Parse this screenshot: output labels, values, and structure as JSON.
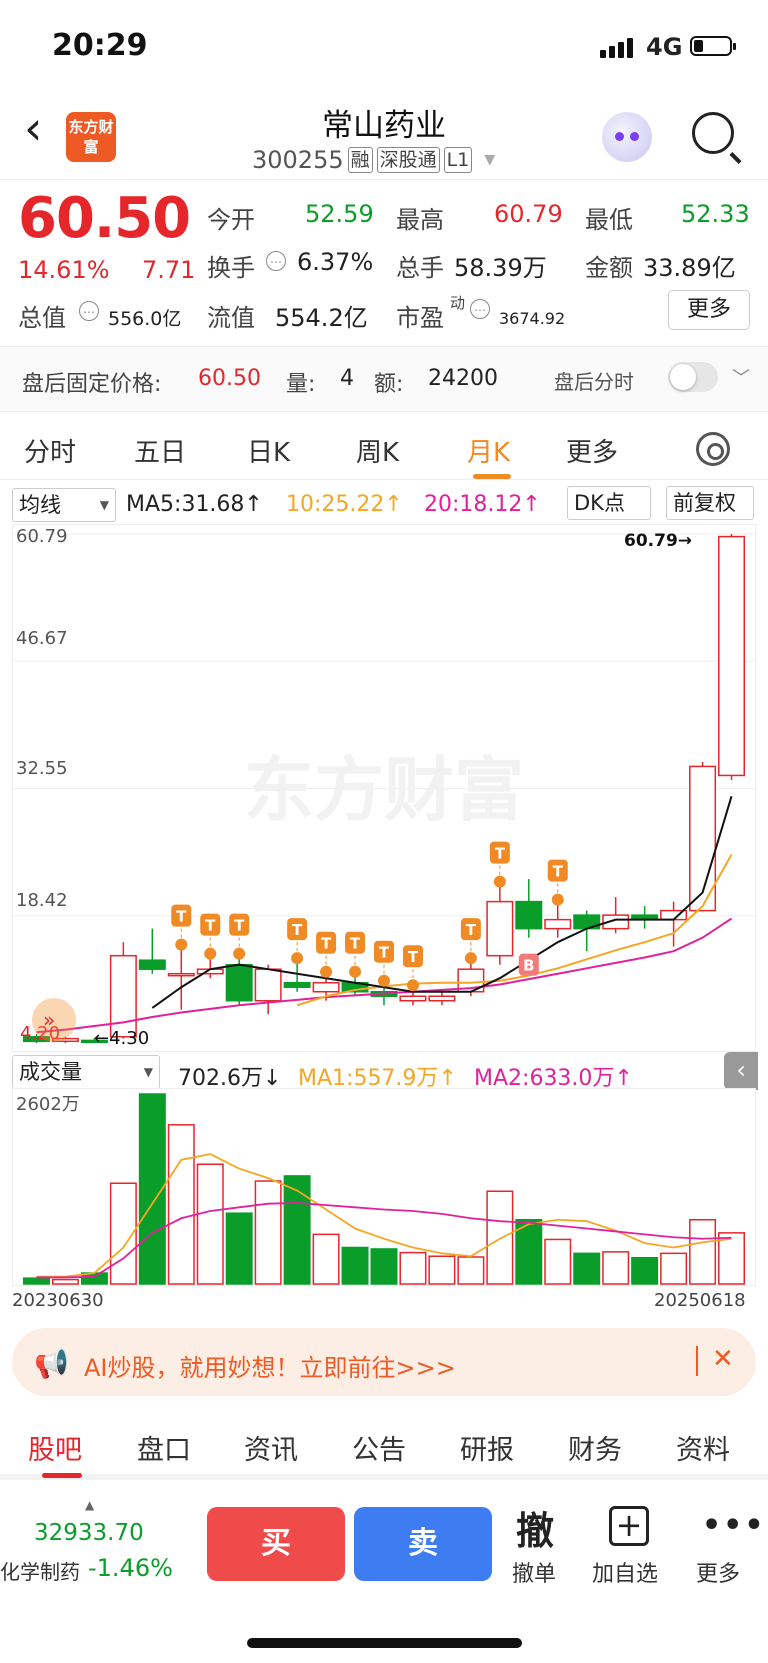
{
  "status": {
    "time": "20:29",
    "network": "4G"
  },
  "header": {
    "title": "常山药业",
    "code": "300255",
    "tags": [
      "融",
      "深股通",
      "L1"
    ],
    "logo_text": "东方财富"
  },
  "quote": {
    "price": "60.50",
    "change_pct": "14.61%",
    "change": "7.71",
    "open_label": "今开",
    "open": "52.59",
    "high_label": "最高",
    "high": "60.79",
    "low_label": "最低",
    "low": "52.33",
    "turnover_label": "换手",
    "turnover": "6.37%",
    "volume_label": "总手",
    "volume": "58.39万",
    "amount_label": "金额",
    "amount": "33.89亿",
    "total_mv_label": "总值",
    "total_mv": "556.0亿",
    "float_mv_label": "流值",
    "float_mv": "554.2亿",
    "pe_label": "市盈",
    "pe_sup": "动",
    "pe": "3674.92",
    "more": "更多"
  },
  "after_hours": {
    "label": "盘后固定价格:",
    "price": "60.50",
    "vol_label": "量:",
    "vol": "4",
    "amt_label": "额:",
    "amt": "24200",
    "switch_label": "盘后分时"
  },
  "period_tabs": [
    "分时",
    "五日",
    "日K",
    "周K",
    "月K",
    "更多"
  ],
  "active_period": "月K",
  "chart_controls": {
    "indicator": "均线",
    "ma5": "MA5:31.68",
    "ma10": "10:25.22",
    "ma20": "20:18.12",
    "dk": "DK点",
    "adjust": "前复权"
  },
  "vol_controls": {
    "indicator": "成交量",
    "vol": "702.6万",
    "ma1": "MA1:557.9万",
    "ma2": "MA2:633.0万"
  },
  "axis": {
    "y": [
      "60.79",
      "46.67",
      "32.55",
      "18.42"
    ],
    "vol_max": "2602万",
    "x_start": "20230630",
    "x_end": "20250618",
    "low_mark": "4.30",
    "high_mark": "60.79",
    "left_label": "4.20"
  },
  "watermark": "东方财富",
  "chart_data": {
    "type": "candlestick",
    "ylim": [
      4.2,
      60.79
    ],
    "candles": [
      {
        "o": 5.0,
        "c": 4.5,
        "h": 5.3,
        "l": 4.3
      },
      {
        "o": 4.5,
        "c": 4.8,
        "h": 5.0,
        "l": 4.3
      },
      {
        "o": 4.6,
        "c": 4.4,
        "h": 4.9,
        "l": 4.3
      },
      {
        "o": 5.0,
        "c": 14.0,
        "h": 15.5,
        "l": 4.8
      },
      {
        "o": 13.5,
        "c": 12.5,
        "h": 17.0,
        "l": 12.0
      },
      {
        "o": 12.0,
        "c": 12.0,
        "h": 15.0,
        "l": 8.0
      },
      {
        "o": 12.0,
        "c": 12.5,
        "h": 14.0,
        "l": 11.5
      },
      {
        "o": 13.0,
        "c": 9.0,
        "h": 14.0,
        "l": 8.5
      },
      {
        "o": 9.0,
        "c": 12.5,
        "h": 13.0,
        "l": 7.5
      },
      {
        "o": 11.0,
        "c": 10.5,
        "h": 13.5,
        "l": 10.0
      },
      {
        "o": 10.0,
        "c": 11.0,
        "h": 12.0,
        "l": 9.0
      },
      {
        "o": 11.0,
        "c": 10.0,
        "h": 12.0,
        "l": 9.5
      },
      {
        "o": 10.0,
        "c": 9.5,
        "h": 11.0,
        "l": 8.5
      },
      {
        "o": 9.0,
        "c": 9.5,
        "h": 10.5,
        "l": 8.5
      },
      {
        "o": 9.0,
        "c": 9.5,
        "h": 10.0,
        "l": 8.5
      },
      {
        "o": 10.0,
        "c": 12.5,
        "h": 13.5,
        "l": 9.5
      },
      {
        "o": 14.0,
        "c": 20.0,
        "h": 22.0,
        "l": 13.0
      },
      {
        "o": 20.0,
        "c": 17.0,
        "h": 22.5,
        "l": 16.0
      },
      {
        "o": 17.0,
        "c": 18.0,
        "h": 20.0,
        "l": 16.0
      },
      {
        "o": 18.5,
        "c": 17.0,
        "h": 19.0,
        "l": 14.5
      },
      {
        "o": 17.0,
        "c": 18.5,
        "h": 20.5,
        "l": 16.5
      },
      {
        "o": 18.5,
        "c": 18.0,
        "h": 19.5,
        "l": 17.0
      },
      {
        "o": 18.0,
        "c": 19.0,
        "h": 20.0,
        "l": 15.0
      },
      {
        "o": 19.0,
        "c": 35.0,
        "h": 35.5,
        "l": 19.0
      },
      {
        "o": 34.0,
        "c": 60.5,
        "h": 60.79,
        "l": 33.5
      }
    ],
    "volumes": [
      80,
      60,
      150,
      1380,
      2602,
      2180,
      1640,
      970,
      1410,
      1480,
      680,
      500,
      480,
      430,
      380,
      370,
      1270,
      880,
      610,
      420,
      440,
      360,
      420,
      880,
      700
    ],
    "vol_ylim": [
      0,
      2602
    ],
    "ma5": [
      null,
      null,
      null,
      null,
      8.2,
      10.5,
      12.5,
      13.0,
      12.5,
      12.0,
      11.5,
      11.0,
      10.5,
      10.0,
      10.0,
      10.0,
      11.5,
      13.5,
      15.5,
      17.0,
      18.0,
      18.0,
      18.0,
      21.0,
      31.68
    ],
    "ma10": [
      null,
      null,
      null,
      null,
      null,
      null,
      null,
      null,
      null,
      8.5,
      9.5,
      10.2,
      10.6,
      10.9,
      11.0,
      11.0,
      11.2,
      11.8,
      12.6,
      13.6,
      14.6,
      15.5,
      16.5,
      19.5,
      25.22
    ],
    "ma20": [
      5.5,
      5.8,
      6.2,
      6.6,
      7.2,
      7.7,
      8.1,
      8.5,
      8.8,
      9.1,
      9.4,
      9.6,
      9.8,
      10.0,
      10.2,
      10.4,
      10.8,
      11.4,
      12.0,
      12.6,
      13.2,
      13.8,
      14.5,
      16.0,
      18.12
    ],
    "vol_ma1": [
      100,
      100,
      150,
      500,
      1100,
      1700,
      1780,
      1580,
      1450,
      1280,
      1020,
      760,
      620,
      500,
      420,
      380,
      620,
      820,
      880,
      860,
      730,
      560,
      500,
      570,
      620
    ],
    "vol_ma2": [
      90,
      90,
      100,
      350,
      700,
      900,
      1000,
      1050,
      1100,
      1110,
      1080,
      1050,
      1020,
      1000,
      960,
      900,
      860,
      840,
      800,
      760,
      720,
      680,
      640,
      620,
      633
    ],
    "t_marks": [
      5,
      6,
      7,
      9,
      10,
      11,
      12,
      13,
      15,
      16,
      18
    ],
    "b_marks": [
      17
    ]
  },
  "ad": {
    "text": "AI炒股，就用妙想！立即前往>>>"
  },
  "bottom_tabs": [
    "股吧",
    "盘口",
    "资讯",
    "公告",
    "研报",
    "财务",
    "资料"
  ],
  "bottom_active": "股吧",
  "footer": {
    "index_value": "32933.70",
    "index_name": "化学制药",
    "index_change": "-1.46%",
    "buy": "买",
    "sell": "卖",
    "cancel_icon": "撤",
    "cancel": "撤单",
    "add_watch": "加自选",
    "more": "更多"
  },
  "colors": {
    "up": "#e5262b",
    "down": "#0a9d2a",
    "accent": "#f08a24",
    "ma5": "#111111",
    "ma10": "#f5a623",
    "ma20": "#e0219b"
  }
}
